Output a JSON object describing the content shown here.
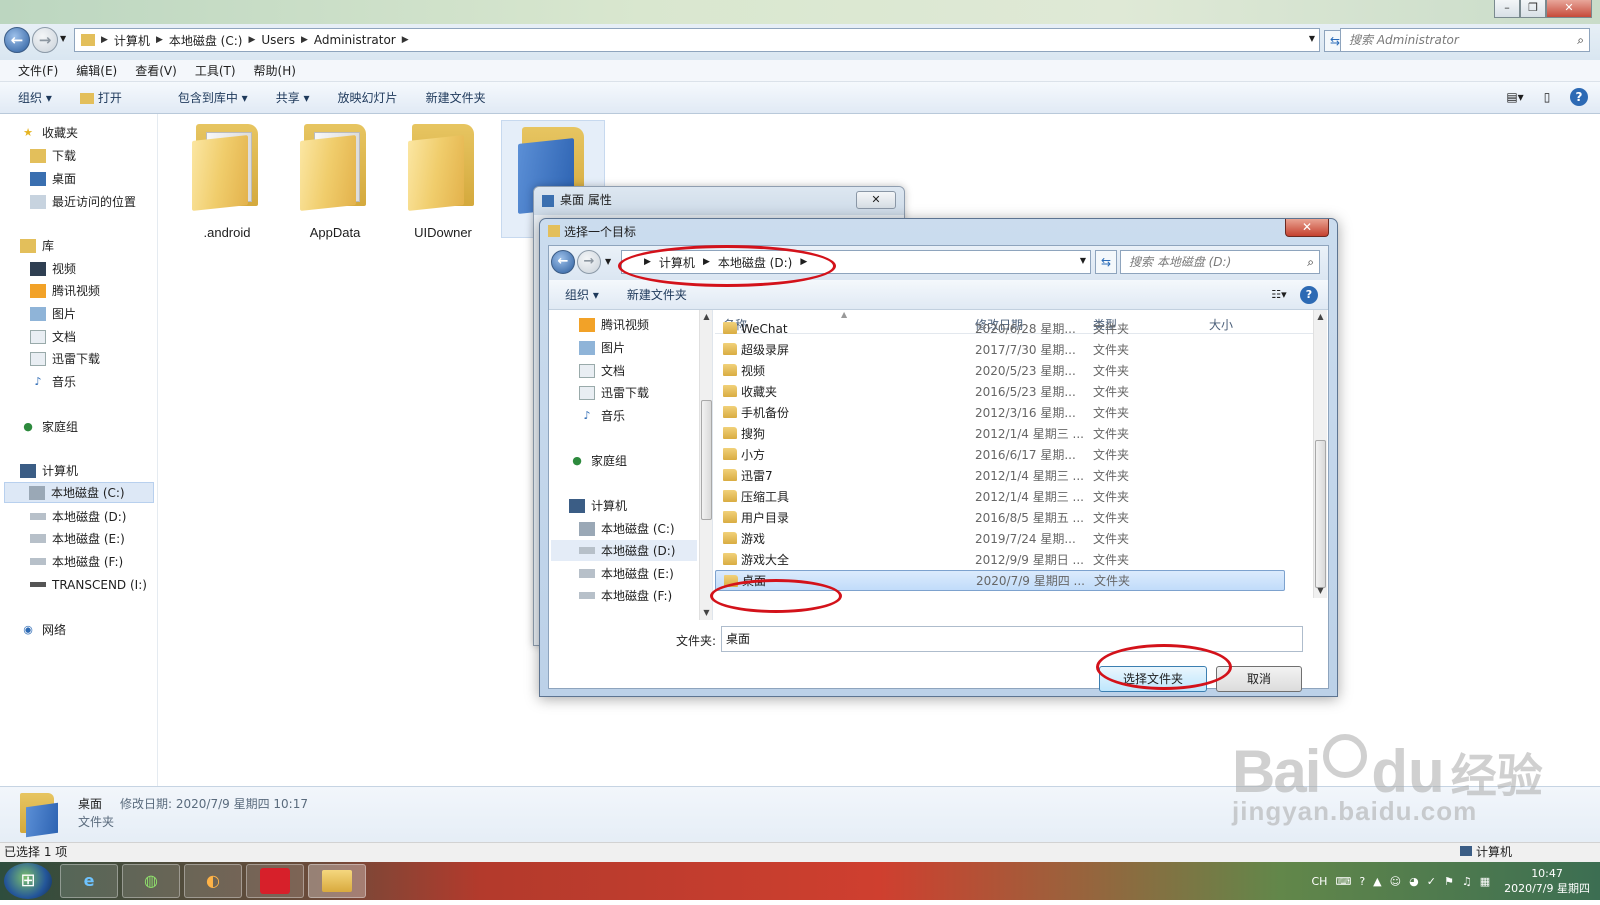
{
  "explorer": {
    "address": {
      "segments": [
        "计算机",
        "本地磁盘 (C:)",
        "Users",
        "Administrator"
      ]
    },
    "search_placeholder": "搜索 Administrator",
    "menu": [
      "文件(F)",
      "编辑(E)",
      "查看(V)",
      "工具(T)",
      "帮助(H)"
    ],
    "toolbar": [
      "组织 ▾",
      "打开",
      "包含到库中 ▾",
      "共享 ▾",
      "放映幻灯片",
      "新建文件夹"
    ],
    "nav": {
      "favorites": "收藏夹",
      "fav_items": [
        "下载",
        "桌面",
        "最近访问的位置"
      ],
      "libraries": "库",
      "lib_items": [
        "视频",
        "腾讯视频",
        "图片",
        "文档",
        "迅雷下载",
        "音乐"
      ],
      "homegroup": "家庭组",
      "computer": "计算机",
      "drives": [
        "本地磁盘 (C:)",
        "本地磁盘 (D:)",
        "本地磁盘 (E:)",
        "本地磁盘 (F:)",
        "TRANSCEND (I:)"
      ],
      "network": "网络"
    },
    "folders": [
      ".android",
      "AppData",
      "UIDowner"
    ],
    "details": {
      "name": "桌面",
      "modified": "修改日期: 2020/7/9 星期四 10:17",
      "type": "文件夹"
    },
    "status": "已选择 1 项",
    "status_right": "计算机"
  },
  "properties": {
    "title": "桌面 属性",
    "close": "✕"
  },
  "dialog": {
    "title": "选择一个目标",
    "close": "✕",
    "address": {
      "segments": [
        "计算机",
        "本地磁盘 (D:)"
      ]
    },
    "search_placeholder": "搜索 本地磁盘 (D:)",
    "toolbar": [
      "组织 ▾",
      "新建文件夹"
    ],
    "tree": {
      "items_top": [
        "腾讯视频",
        "图片",
        "文档",
        "迅雷下载",
        "音乐"
      ],
      "homegroup": "家庭组",
      "computer": "计算机",
      "drives": [
        "本地磁盘 (C:)",
        "本地磁盘 (D:)",
        "本地磁盘 (E:)",
        "本地磁盘 (F:)"
      ]
    },
    "columns": {
      "name": "名称",
      "date": "修改日期",
      "type": "类型",
      "size": "大小"
    },
    "rows": [
      {
        "name": "WeChat",
        "date": "2020/6/28 星期...",
        "type": "文件夹"
      },
      {
        "name": "超级录屏",
        "date": "2017/7/30 星期...",
        "type": "文件夹"
      },
      {
        "name": "视频",
        "date": "2020/5/23 星期...",
        "type": "文件夹"
      },
      {
        "name": "收藏夹",
        "date": "2016/5/23 星期...",
        "type": "文件夹"
      },
      {
        "name": "手机备份",
        "date": "2012/3/16 星期...",
        "type": "文件夹"
      },
      {
        "name": "搜狗",
        "date": "2012/1/4 星期三 ...",
        "type": "文件夹"
      },
      {
        "name": "小方",
        "date": "2016/6/17 星期...",
        "type": "文件夹"
      },
      {
        "name": "迅雷7",
        "date": "2012/1/4 星期三 ...",
        "type": "文件夹"
      },
      {
        "name": "压缩工具",
        "date": "2012/1/4 星期三 ...",
        "type": "文件夹"
      },
      {
        "name": "用户目录",
        "date": "2016/8/5 星期五 ...",
        "type": "文件夹"
      },
      {
        "name": "游戏",
        "date": "2019/7/24 星期...",
        "type": "文件夹"
      },
      {
        "name": "游戏大全",
        "date": "2012/9/9 星期日 ...",
        "type": "文件夹"
      },
      {
        "name": "桌面",
        "date": "2020/7/9 星期四 ...",
        "type": "文件夹"
      }
    ],
    "folder_label": "文件夹:",
    "folder_value": "桌面",
    "ok": "选择文件夹",
    "cancel": "取消"
  },
  "taskbar": {
    "ime": "CH",
    "time": "10:47",
    "date": "2020/7/9 星期四"
  },
  "watermark": {
    "brand": "Bai",
    "brand2": "du",
    "cn": "经验",
    "url": "jingyan.baidu.com"
  }
}
